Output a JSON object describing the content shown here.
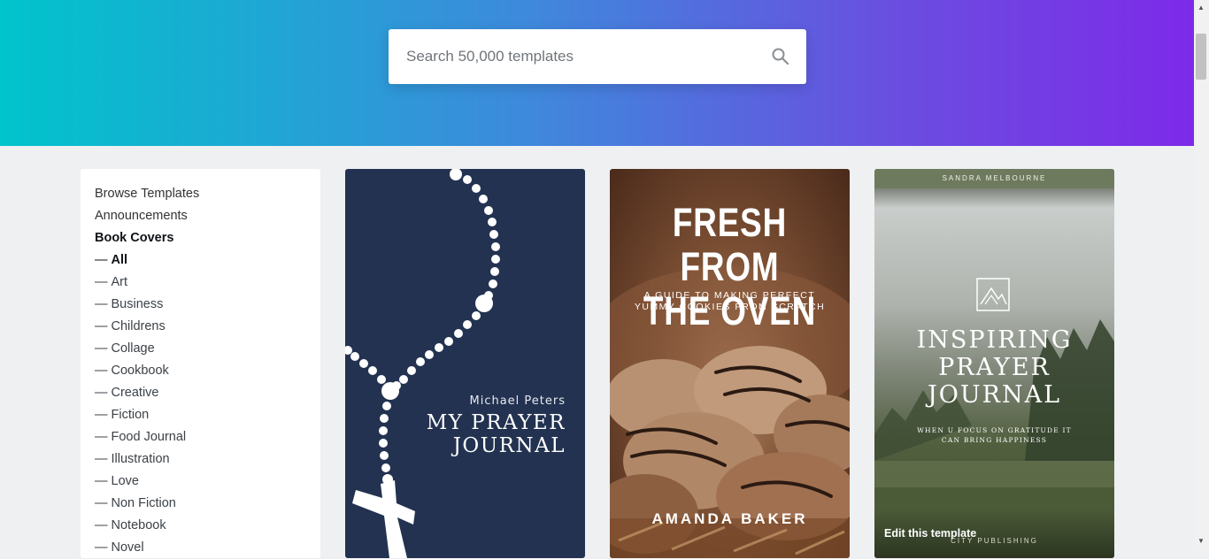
{
  "search": {
    "placeholder": "Search 50,000 templates",
    "icon": "search-icon"
  },
  "sidebar": {
    "items": [
      {
        "label": "Browse Templates"
      },
      {
        "label": "Announcements"
      },
      {
        "label": "Book Covers"
      }
    ],
    "sub_prefix": "—",
    "sub_items": [
      {
        "label": "All",
        "active": true
      },
      {
        "label": "Art"
      },
      {
        "label": "Business"
      },
      {
        "label": "Childrens"
      },
      {
        "label": "Collage"
      },
      {
        "label": "Cookbook"
      },
      {
        "label": "Creative"
      },
      {
        "label": "Fiction"
      },
      {
        "label": "Food Journal"
      },
      {
        "label": "Illustration"
      },
      {
        "label": "Love"
      },
      {
        "label": "Non Fiction"
      },
      {
        "label": "Notebook"
      },
      {
        "label": "Novel"
      }
    ]
  },
  "templates": [
    {
      "author": "Michael Peters",
      "title": "MY PRAYER\nJOURNAL",
      "background": "#223250"
    },
    {
      "title": "FRESH FROM\nTHE OVEN",
      "subtitle": "A GUIDE TO MAKING PERFECT\nYUMMY COOKIES FROM SCRATCH",
      "author": "AMANDA BAKER"
    },
    {
      "author": "SANDRA MELBOURNE",
      "title": "INSPIRING\nPRAYER\nJOURNAL",
      "subtitle": "WHEN U FOCUS ON GRATITUDE IT\nCAN BRING HAPPINESS",
      "publisher": "CITY PUBLISHING",
      "hover_label": "Edit this template"
    }
  ],
  "colors": {
    "gradient_start": "#00c4cc",
    "gradient_end": "#7d2ae8",
    "page_background": "#eef0f2"
  }
}
